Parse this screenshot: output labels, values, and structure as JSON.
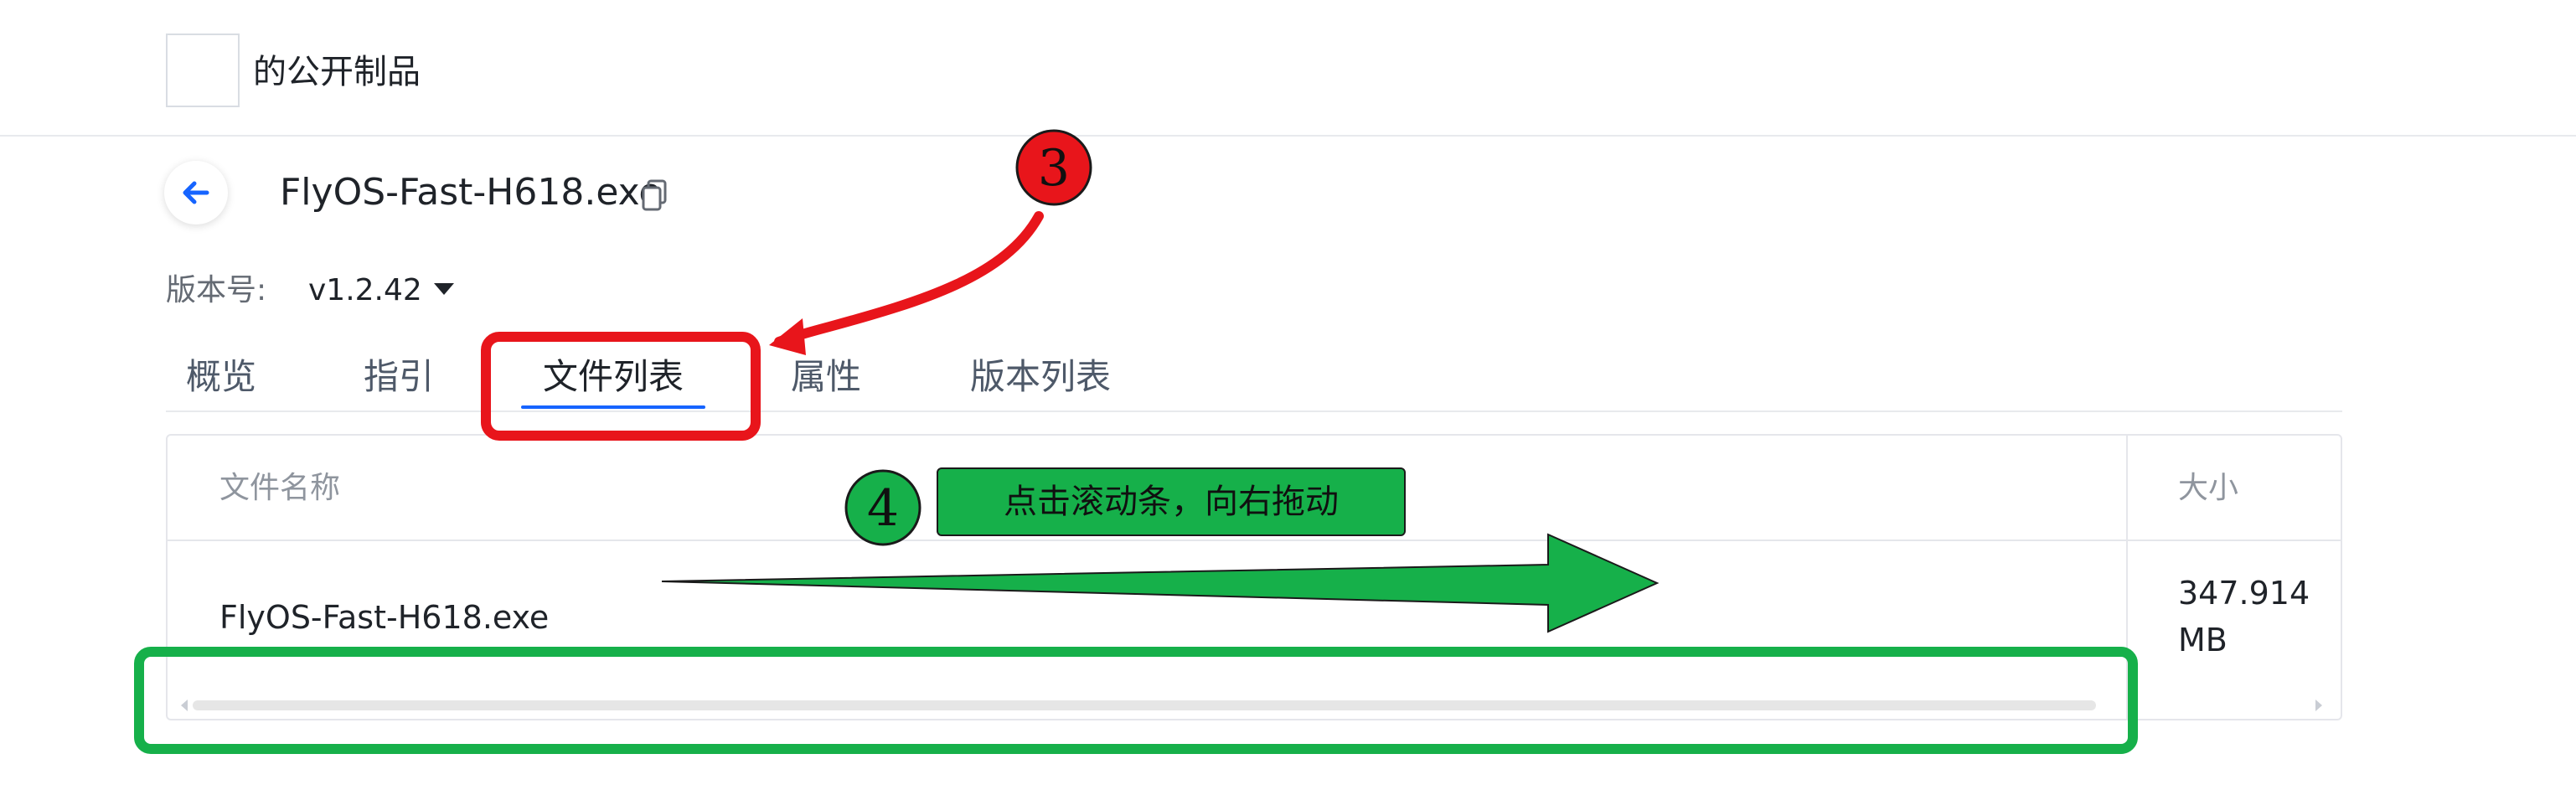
{
  "header": {
    "title": "的公开制品"
  },
  "file": {
    "name": "FlyOS-Fast-H618.exe"
  },
  "version": {
    "label": "版本号:",
    "value": "v1.2.42"
  },
  "tabs": [
    {
      "label": "概览"
    },
    {
      "label": "指引"
    },
    {
      "label": "文件列表",
      "active": true
    },
    {
      "label": "属性"
    },
    {
      "label": "版本列表"
    }
  ],
  "table": {
    "columns": [
      "文件名称",
      "大小"
    ],
    "rows": [
      {
        "name": "FlyOS-Fast-H618.exe",
        "size": "347.914 MB"
      }
    ]
  },
  "annotations": {
    "step3": "3",
    "step4": "4",
    "step4_text": "点击滚动条，向右拖动"
  },
  "colors": {
    "accent": "#1664ff",
    "highlight_red": "#e8151b",
    "highlight_green": "#16b04a"
  }
}
